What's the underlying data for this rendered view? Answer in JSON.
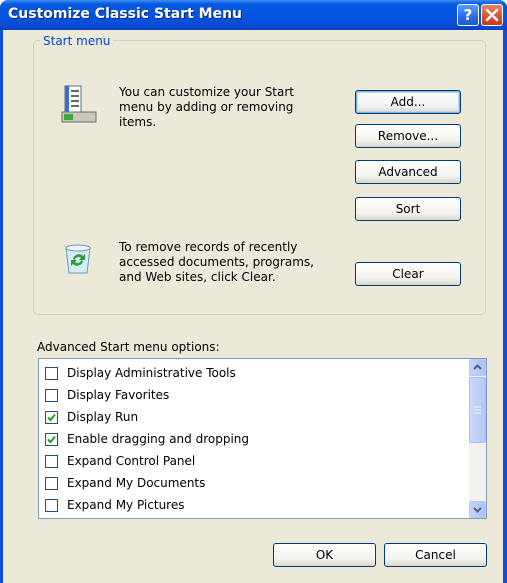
{
  "window": {
    "title": "Customize Classic Start Menu",
    "help_glyph": "?",
    "close_glyph": "X"
  },
  "start_menu_group": {
    "label": "Start menu",
    "customize_text_line1": "You can customize your Start",
    "customize_text_line2": "menu by adding or removing",
    "customize_text_line3": "items.",
    "clear_text_line1": "To remove records of recently",
    "clear_text_line2": "accessed documents, programs,",
    "clear_text_line3": "and Web sites, click Clear.",
    "buttons": {
      "add": "Add...",
      "remove": "Remove...",
      "advanced": "Advanced",
      "sort": "Sort",
      "clear": "Clear"
    }
  },
  "advanced_options": {
    "label": "Advanced Start menu options:",
    "items": [
      {
        "label": "Display Administrative Tools",
        "checked": false
      },
      {
        "label": "Display Favorites",
        "checked": false
      },
      {
        "label": "Display Run",
        "checked": true
      },
      {
        "label": "Enable dragging and dropping",
        "checked": true
      },
      {
        "label": "Expand Control Panel",
        "checked": false
      },
      {
        "label": "Expand My Documents",
        "checked": false
      },
      {
        "label": "Expand My Pictures",
        "checked": false
      }
    ]
  },
  "footer": {
    "ok": "OK",
    "cancel": "Cancel"
  }
}
